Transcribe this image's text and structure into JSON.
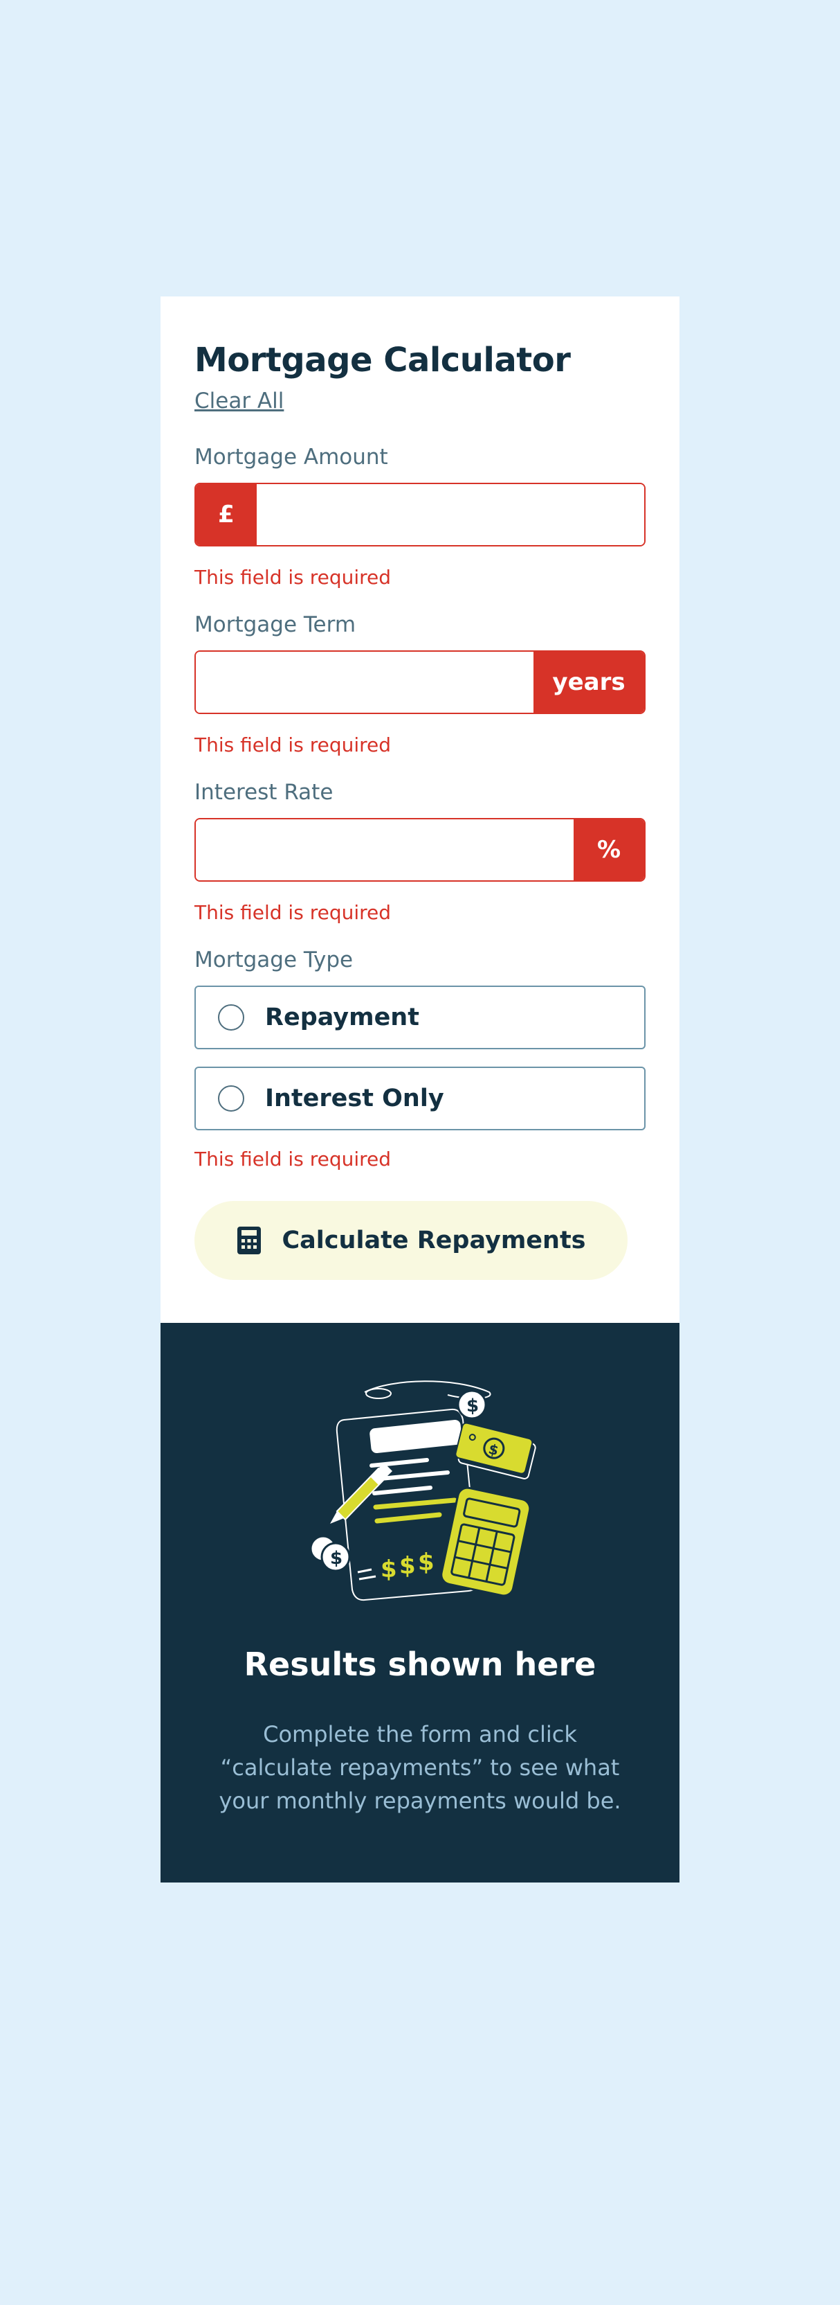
{
  "form": {
    "title": "Mortgage Calculator",
    "clear_label": "Clear All",
    "amount": {
      "label": "Mortgage Amount",
      "prefix": "£",
      "value": "",
      "error": "This field is required"
    },
    "term": {
      "label": "Mortgage Term",
      "suffix": "years",
      "value": "",
      "error": "This field is required"
    },
    "rate": {
      "label": "Interest Rate",
      "suffix": "%",
      "value": "",
      "error": "This field is required"
    },
    "type": {
      "label": "Mortgage Type",
      "options": [
        {
          "label": "Repayment"
        },
        {
          "label": "Interest Only"
        }
      ],
      "error": "This field is required"
    },
    "submit_label": "Calculate Repayments"
  },
  "results": {
    "title": "Results shown here",
    "text": "Complete the form and click “calculate repayments” to see what your monthly repayments would be."
  },
  "colors": {
    "page_background": "#e0f0fb",
    "error_red": "#d73328",
    "dark_slate": "#133041",
    "lime": "#d8db2f",
    "button_background": "#f9f9e0"
  },
  "icons": {
    "submit": "calculator-icon",
    "illustration": "mortgage-documents-illustration"
  }
}
